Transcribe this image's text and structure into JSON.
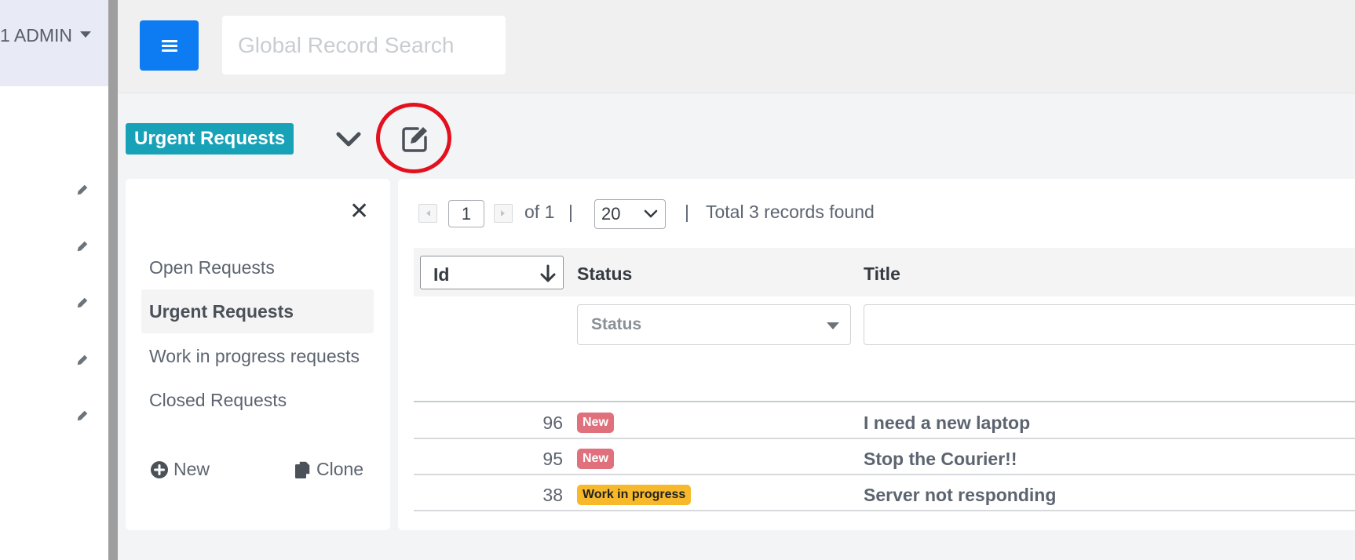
{
  "user_menu": {
    "label": "1 ADMIN"
  },
  "header": {
    "search_placeholder": "Global Record Search"
  },
  "report": {
    "title": "Urgent Requests"
  },
  "side_panel": {
    "items": [
      {
        "label": "Open Requests",
        "active": false
      },
      {
        "label": "Urgent Requests",
        "active": true
      },
      {
        "label": "Work in progress requests",
        "active": false
      },
      {
        "label": "Closed Requests",
        "active": false
      }
    ],
    "new_label": "New",
    "clone_label": "Clone"
  },
  "pagination": {
    "page": "1",
    "of_label": "of 1",
    "separator": "|",
    "page_size": "20",
    "total_label": "Total 3 records found"
  },
  "table": {
    "columns": {
      "id": "Id",
      "status": "Status",
      "title": "Title"
    },
    "status_filter_placeholder": "Status",
    "rows": [
      {
        "id": "96",
        "status": "New",
        "status_type": "new",
        "title": "I need a new laptop"
      },
      {
        "id": "95",
        "status": "New",
        "status_type": "new",
        "title": "Stop the Courier!!"
      },
      {
        "id": "38",
        "status": "Work in progress",
        "status_type": "wip",
        "title": "Server not responding"
      }
    ]
  },
  "colors": {
    "accent": "#0d7cf2",
    "title_badge": "#17a2b8",
    "badge_new": "#e0707c",
    "badge_wip": "#f7b92b",
    "highlight_circle": "#e3101e"
  },
  "icons": {
    "menu": "hamburger-icon",
    "chevron": "chevron-down-icon",
    "edit": "edit-icon",
    "close": "close-icon",
    "new": "plus-circle-icon",
    "clone": "copy-icon",
    "sort": "arrow-down-icon"
  }
}
